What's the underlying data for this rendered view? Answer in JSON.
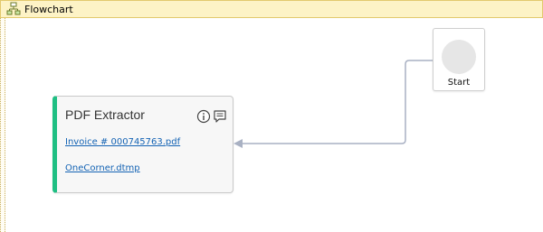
{
  "header": {
    "title": "Flowchart",
    "icon": "flowchart-icon"
  },
  "start_node": {
    "label": "Start"
  },
  "activity": {
    "title": "PDF Extractor",
    "accent_color": "#1fbf83",
    "icons": [
      "info-icon",
      "comment-icon"
    ],
    "links": [
      "Invoice # 000745763.pdf",
      "OneCorner.dtmp"
    ]
  },
  "colors": {
    "header_background": "#fdf3c6",
    "link": "#1463b4",
    "connector": "#a9b1c3"
  }
}
